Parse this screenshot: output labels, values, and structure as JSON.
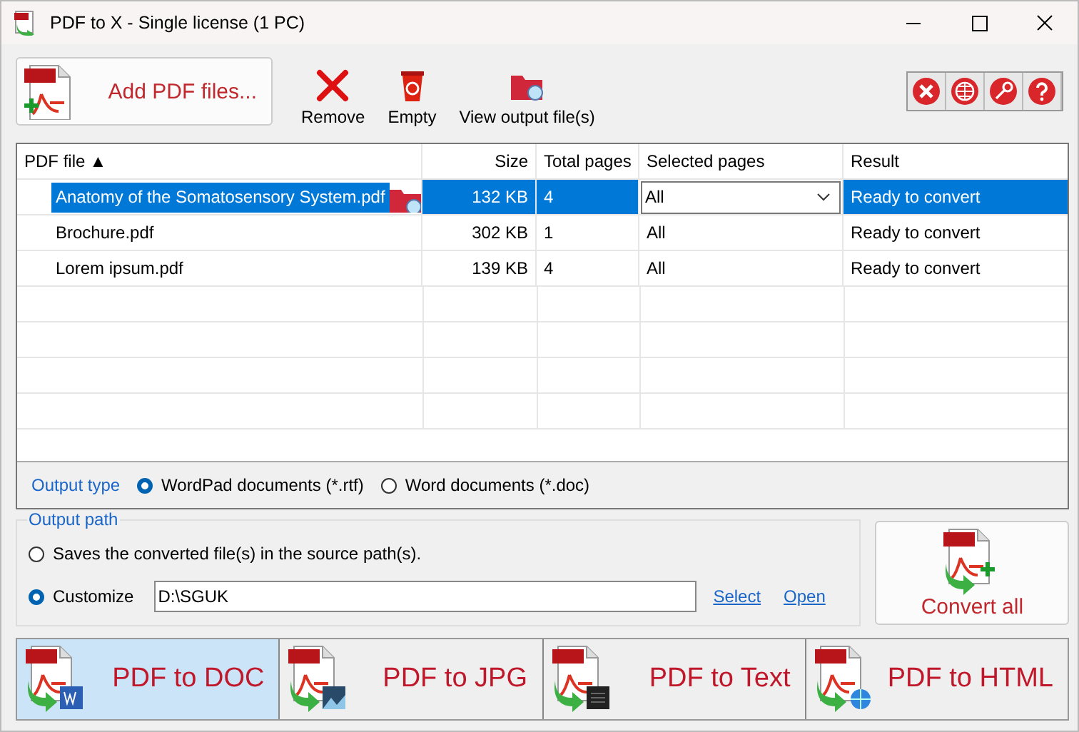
{
  "window": {
    "title": "PDF to X - Single license (1 PC)"
  },
  "toolbar": {
    "add_button": "Add PDF files...",
    "buttons": [
      {
        "label": "Remove",
        "kind": "remove"
      },
      {
        "label": "Empty",
        "kind": "empty"
      },
      {
        "label": "View output file(s)",
        "kind": "view"
      }
    ],
    "icon_buttons": [
      {
        "kind": "tools"
      },
      {
        "kind": "web"
      },
      {
        "kind": "key"
      },
      {
        "kind": "help"
      }
    ]
  },
  "table": {
    "columns": [
      {
        "label": "PDF file",
        "sort_mark": "▲"
      },
      {
        "label": "Size"
      },
      {
        "label": "Total pages"
      },
      {
        "label": "Selected pages"
      },
      {
        "label": "Result"
      }
    ],
    "rows": [
      {
        "file": "Anatomy of the Somatosensory System.pdf",
        "size": "132 KB",
        "total_pages": "4",
        "selected_pages": "All",
        "result": "Ready to convert",
        "selected": true
      },
      {
        "file": "Brochure.pdf",
        "size": "302 KB",
        "total_pages": "1",
        "selected_pages": "All",
        "result": "Ready to convert",
        "selected": false
      },
      {
        "file": "Lorem ipsum.pdf",
        "size": "139 KB",
        "total_pages": "4",
        "selected_pages": "All",
        "result": "Ready to convert",
        "selected": false
      }
    ]
  },
  "output_type": {
    "label": "Output type",
    "options": [
      {
        "label": "WordPad documents (*.rtf)",
        "selected": true
      },
      {
        "label": "Word documents (*.doc)",
        "selected": false
      }
    ]
  },
  "output_path": {
    "title": "Output path",
    "options": [
      {
        "label": "Saves the converted file(s) in the source path(s).",
        "selected": false
      },
      {
        "label": "Customize",
        "selected": true
      }
    ],
    "path": "D:\\SGUK",
    "links": [
      "Select",
      "Open"
    ]
  },
  "convert_button": "Convert all",
  "modes": [
    {
      "label": "PDF to DOC",
      "kind": "doc",
      "selected": true
    },
    {
      "label": "PDF to JPG",
      "kind": "jpg",
      "selected": false
    },
    {
      "label": "PDF to Text",
      "kind": "text",
      "selected": false
    },
    {
      "label": "PDF to HTML",
      "kind": "html",
      "selected": false
    }
  ]
}
